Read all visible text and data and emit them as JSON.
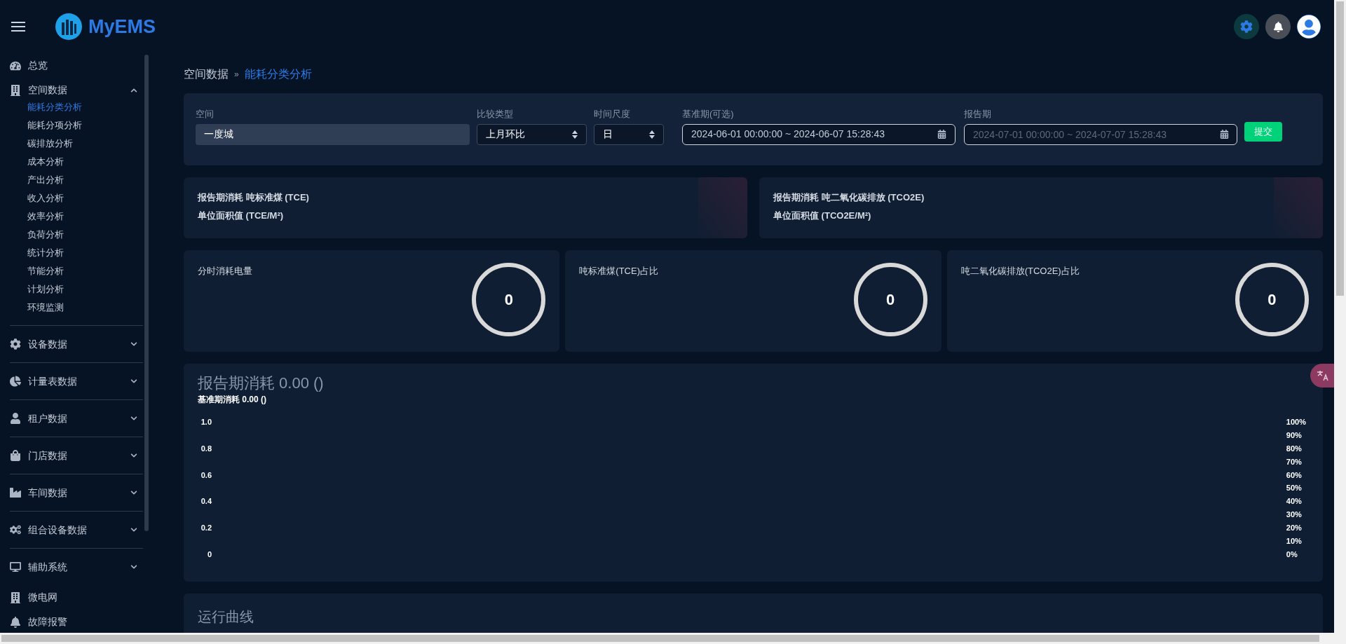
{
  "header": {
    "logo_text": "MyEMS"
  },
  "sidebar": {
    "items": [
      {
        "label": "总览"
      },
      {
        "label": "空间数据",
        "expanded": true,
        "children": [
          {
            "label": "能耗分类分析",
            "selected": true
          },
          {
            "label": "能耗分项分析",
            "selected": false
          },
          {
            "label": "碳排放分析",
            "selected": false
          },
          {
            "label": "成本分析",
            "selected": false
          },
          {
            "label": "产出分析",
            "selected": false
          },
          {
            "label": "收入分析",
            "selected": false
          },
          {
            "label": "效率分析",
            "selected": false
          },
          {
            "label": "负荷分析",
            "selected": false
          },
          {
            "label": "统计分析",
            "selected": false
          },
          {
            "label": "节能分析",
            "selected": false
          },
          {
            "label": "计划分析",
            "selected": false
          },
          {
            "label": "环境监测",
            "selected": false
          }
        ]
      },
      {
        "label": "设备数据",
        "expanded": false
      },
      {
        "label": "计量表数据",
        "expanded": false
      },
      {
        "label": "租户数据",
        "expanded": false
      },
      {
        "label": "门店数据",
        "expanded": false
      },
      {
        "label": "车间数据",
        "expanded": false
      },
      {
        "label": "组合设备数据",
        "expanded": false
      },
      {
        "label": "辅助系统",
        "expanded": false
      },
      {
        "label": "微电网"
      },
      {
        "label": "故障报警"
      }
    ]
  },
  "breadcrumb": {
    "parent": "空间数据",
    "separator": "»",
    "current": "能耗分类分析"
  },
  "filters": {
    "space": {
      "label": "空间",
      "value": "一度城"
    },
    "compare_type": {
      "label": "比较类型",
      "value": "上月环比"
    },
    "time_scale": {
      "label": "时间尺度",
      "value": "日"
    },
    "base_period": {
      "label": "基准期(可选)",
      "value": "2024-06-01 00:00:00 ~ 2024-06-07 15:28:43"
    },
    "report_period": {
      "label": "报告期",
      "placeholder": "2024-07-01 00:00:00 ~ 2024-07-07 15:28:43"
    },
    "submit": "提交"
  },
  "kpi_cards": [
    {
      "title": "报告期消耗 吨标准煤 (TCE)",
      "subtitle": "单位面积值 (TCE/M²)"
    },
    {
      "title": "报告期消耗 吨二氧化碳排放 (TCO2E)",
      "subtitle": "单位面积值 (TCO2E/M²)"
    }
  ],
  "ring_cards": [
    {
      "title": "分时消耗电量",
      "value": "0"
    },
    {
      "title": "吨标准煤(TCE)占比",
      "value": "0"
    },
    {
      "title": "吨二氧化碳排放(TCO2E)占比",
      "value": "0"
    }
  ],
  "chart_panel": {
    "title": "报告期消耗 0.00 ()",
    "subtitle": "基准期消耗 0.00 ()",
    "left_axis": [
      "1.0",
      "0.8",
      "0.6",
      "0.4",
      "0.2",
      "0"
    ],
    "right_axis": [
      "100%",
      "90%",
      "80%",
      "70%",
      "60%",
      "50%",
      "40%",
      "30%",
      "20%",
      "10%",
      "0%"
    ]
  },
  "curve_panel": {
    "title": "运行曲线"
  }
}
